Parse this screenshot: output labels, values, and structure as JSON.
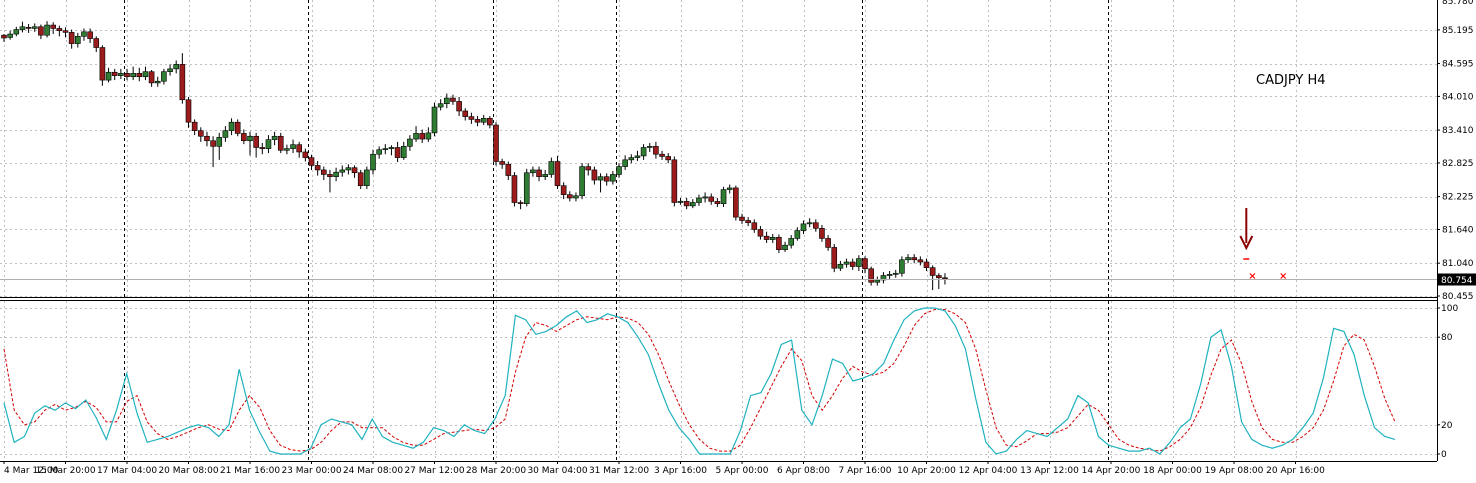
{
  "chart_data": {
    "type": "candlestick",
    "title": "CADJPY H4",
    "colors": {
      "bull_candle": "#2e7d32",
      "bear_candle": "#9b1c1c",
      "wick": "#000000",
      "stoch_main": "#20b2c0",
      "stoch_signal": "#d40000",
      "marker_arrow": "#8b0000",
      "marker_x": "#ff0000",
      "grid": "#c0c0c0",
      "separator": "#000000"
    },
    "price_axis": {
      "ylim": [
        80.455,
        85.78
      ],
      "ticks": [
        "85.195",
        "84.595",
        "84.010",
        "83.410",
        "82.825",
        "82.225",
        "81.640",
        "81.040",
        "80.455"
      ],
      "top_label_partial": "85.780",
      "current_price": "80.754"
    },
    "time_axis": {
      "labels": [
        "4 Mar 12:00",
        "15 Mar 20:00",
        "17 Mar 04:00",
        "20 Mar 08:00",
        "21 Mar 16:00",
        "23 Mar 00:00",
        "24 Mar 08:00",
        "27 Mar 12:00",
        "28 Mar 20:00",
        "30 Mar 04:00",
        "31 Mar 12:00",
        "3 Apr 16:00",
        "5 Apr 00:00",
        "6 Apr 08:00",
        "7 Apr 16:00",
        "10 Apr 20:00",
        "12 Apr 04:00",
        "13 Apr 12:00",
        "14 Apr 20:00",
        "18 Apr 00:00",
        "19 Apr 08:00",
        "20 Apr 16:00"
      ],
      "label_bar_index": [
        0,
        10,
        20,
        30,
        40,
        50,
        60,
        70,
        80,
        90,
        100,
        110,
        120,
        130,
        140,
        150,
        160,
        170,
        180,
        190,
        200,
        210
      ],
      "day_separator_bar_index": [
        20,
        50,
        80,
        100,
        140,
        180
      ]
    },
    "candles": [
      [
        85.1,
        85.05,
        85.12,
        84.98
      ],
      [
        85.06,
        85.12,
        85.18,
        85.02
      ],
      [
        85.12,
        85.2,
        85.25,
        85.08
      ],
      [
        85.2,
        85.25,
        85.34,
        85.15
      ],
      [
        85.24,
        85.22,
        85.3,
        85.14
      ],
      [
        85.22,
        85.25,
        85.31,
        85.16
      ],
      [
        85.25,
        85.1,
        85.29,
        85.03
      ],
      [
        85.1,
        85.28,
        85.35,
        85.06
      ],
      [
        85.28,
        85.22,
        85.33,
        85.12
      ],
      [
        85.22,
        85.18,
        85.27,
        85.08
      ],
      [
        85.18,
        85.15,
        85.24,
        85.06
      ],
      [
        85.15,
        84.95,
        85.2,
        84.86
      ],
      [
        84.95,
        85.08,
        85.14,
        84.88
      ],
      [
        85.08,
        85.16,
        85.22,
        85.0
      ],
      [
        85.16,
        85.04,
        85.22,
        84.96
      ],
      [
        85.04,
        84.88,
        85.08,
        84.8
      ],
      [
        84.88,
        84.3,
        84.92,
        84.2
      ],
      [
        84.3,
        84.44,
        84.52,
        84.26
      ],
      [
        84.44,
        84.38,
        84.5,
        84.3
      ],
      [
        84.38,
        84.42,
        84.5,
        84.32
      ],
      [
        84.42,
        84.36,
        84.5,
        84.3
      ],
      [
        84.36,
        84.42,
        84.54,
        84.3
      ],
      [
        84.42,
        84.36,
        84.52,
        84.28
      ],
      [
        84.36,
        84.45,
        84.54,
        84.3
      ],
      [
        84.45,
        84.25,
        84.48,
        84.18
      ],
      [
        84.25,
        84.28,
        84.36,
        84.18
      ],
      [
        84.28,
        84.45,
        84.5,
        84.22
      ],
      [
        84.45,
        84.5,
        84.58,
        84.38
      ],
      [
        84.5,
        84.58,
        84.65,
        84.42
      ],
      [
        84.58,
        83.95,
        84.78,
        83.88
      ],
      [
        83.95,
        83.55,
        84.0,
        83.45
      ],
      [
        83.55,
        83.4,
        83.6,
        83.32
      ],
      [
        83.4,
        83.3,
        83.46,
        83.2
      ],
      [
        83.3,
        83.22,
        83.38,
        83.12
      ],
      [
        83.22,
        83.12,
        83.3,
        82.75
      ],
      [
        83.12,
        83.28,
        83.36,
        82.88
      ],
      [
        83.28,
        83.4,
        83.48,
        83.2
      ],
      [
        83.4,
        83.55,
        83.62,
        83.32
      ],
      [
        83.55,
        83.35,
        83.6,
        83.3
      ],
      [
        83.35,
        83.22,
        83.42,
        83.16
      ],
      [
        83.22,
        83.3,
        83.38,
        82.96
      ],
      [
        83.3,
        83.1,
        83.36,
        82.92
      ],
      [
        83.1,
        83.08,
        83.18,
        82.98
      ],
      [
        83.08,
        83.24,
        83.32,
        83.0
      ],
      [
        83.24,
        83.3,
        83.38,
        83.14
      ],
      [
        83.3,
        83.05,
        83.36,
        83.0
      ],
      [
        83.05,
        83.08,
        83.15,
        82.98
      ],
      [
        83.08,
        83.15,
        83.24,
        83.0
      ],
      [
        83.15,
        83.02,
        83.2,
        82.92
      ],
      [
        83.02,
        82.92,
        83.08,
        82.85
      ],
      [
        82.92,
        82.78,
        82.97,
        82.7
      ],
      [
        82.78,
        82.7,
        82.86,
        82.6
      ],
      [
        82.7,
        82.62,
        82.76,
        82.52
      ],
      [
        82.62,
        82.58,
        82.7,
        82.3
      ],
      [
        82.58,
        82.66,
        82.74,
        82.5
      ],
      [
        82.66,
        82.7,
        82.78,
        82.58
      ],
      [
        82.7,
        82.74,
        82.8,
        82.62
      ],
      [
        82.74,
        82.65,
        82.78,
        82.56
      ],
      [
        82.65,
        82.42,
        82.7,
        82.36
      ],
      [
        82.42,
        82.7,
        82.76,
        82.36
      ],
      [
        82.7,
        82.98,
        83.06,
        82.62
      ],
      [
        82.98,
        83.06,
        83.12,
        82.9
      ],
      [
        83.06,
        83.08,
        83.16,
        82.98
      ],
      [
        83.08,
        83.1,
        83.14,
        82.96
      ],
      [
        83.1,
        82.92,
        83.2,
        82.84
      ],
      [
        82.92,
        83.12,
        83.2,
        82.88
      ],
      [
        83.12,
        83.25,
        83.32,
        83.04
      ],
      [
        83.25,
        83.35,
        83.48,
        83.2
      ],
      [
        83.35,
        83.25,
        83.42,
        83.18
      ],
      [
        83.25,
        83.36,
        83.46,
        83.2
      ],
      [
        83.36,
        83.82,
        83.9,
        83.3
      ],
      [
        83.82,
        83.88,
        83.96,
        83.76
      ],
      [
        83.88,
        83.98,
        84.06,
        83.8
      ],
      [
        83.98,
        83.92,
        84.04,
        83.86
      ],
      [
        83.92,
        83.75,
        84.0,
        83.66
      ],
      [
        83.75,
        83.65,
        83.8,
        83.58
      ],
      [
        83.65,
        83.6,
        83.72,
        83.52
      ],
      [
        83.6,
        83.55,
        83.66,
        83.48
      ],
      [
        83.55,
        83.62,
        83.68,
        83.5
      ],
      [
        83.62,
        83.5,
        83.66,
        83.44
      ],
      [
        83.5,
        82.85,
        83.55,
        82.78
      ],
      [
        82.85,
        82.8,
        82.9,
        82.72
      ],
      [
        82.8,
        82.6,
        82.85,
        82.52
      ],
      [
        82.6,
        82.12,
        82.66,
        82.05
      ],
      [
        82.12,
        82.1,
        82.16,
        82.0
      ],
      [
        82.1,
        82.65,
        82.72,
        82.05
      ],
      [
        82.65,
        82.7,
        82.76,
        82.58
      ],
      [
        82.7,
        82.58,
        82.76,
        82.5
      ],
      [
        82.58,
        82.62,
        82.7,
        82.52
      ],
      [
        82.62,
        82.85,
        82.92,
        82.56
      ],
      [
        82.85,
        82.42,
        82.95,
        82.36
      ],
      [
        82.42,
        82.26,
        82.48,
        82.18
      ],
      [
        82.26,
        82.2,
        82.32,
        82.14
      ],
      [
        82.2,
        82.24,
        82.3,
        82.14
      ],
      [
        82.24,
        82.76,
        82.82,
        82.18
      ],
      [
        82.76,
        82.7,
        82.82,
        82.6
      ],
      [
        82.7,
        82.52,
        82.76,
        82.44
      ],
      [
        82.52,
        82.58,
        82.64,
        82.3
      ],
      [
        82.58,
        82.5,
        82.64,
        82.42
      ],
      [
        82.5,
        82.62,
        82.68,
        82.44
      ],
      [
        82.62,
        82.76,
        82.82,
        82.56
      ],
      [
        82.76,
        82.88,
        82.96,
        82.7
      ],
      [
        82.88,
        82.92,
        82.98,
        82.82
      ],
      [
        82.92,
        82.95,
        83.04,
        82.86
      ],
      [
        82.95,
        83.1,
        83.16,
        82.88
      ],
      [
        83.1,
        83.12,
        83.18,
        83.02
      ],
      [
        83.12,
        82.98,
        83.2,
        82.9
      ],
      [
        82.98,
        82.94,
        83.04,
        82.88
      ],
      [
        82.94,
        82.88,
        83.0,
        82.82
      ],
      [
        82.88,
        82.12,
        82.94,
        82.05
      ],
      [
        82.12,
        82.14,
        82.2,
        82.08
      ],
      [
        82.14,
        82.06,
        82.2,
        82.0
      ],
      [
        82.06,
        82.12,
        82.18,
        82.02
      ],
      [
        82.12,
        82.2,
        82.26,
        82.06
      ],
      [
        82.2,
        82.22,
        82.3,
        82.12
      ],
      [
        82.22,
        82.14,
        82.28,
        82.08
      ],
      [
        82.14,
        82.1,
        82.2,
        82.04
      ],
      [
        82.1,
        82.35,
        82.4,
        82.04
      ],
      [
        82.35,
        82.38,
        82.44,
        82.28
      ],
      [
        82.38,
        81.86,
        82.42,
        81.8
      ],
      [
        81.86,
        81.8,
        81.92,
        81.74
      ],
      [
        81.8,
        81.76,
        81.86,
        81.7
      ],
      [
        81.76,
        81.64,
        81.82,
        81.58
      ],
      [
        81.64,
        81.52,
        81.7,
        81.46
      ],
      [
        81.52,
        81.46,
        81.6,
        81.4
      ],
      [
        81.46,
        81.5,
        81.56,
        81.4
      ],
      [
        81.5,
        81.28,
        81.55,
        81.22
      ],
      [
        81.28,
        81.36,
        81.42,
        81.24
      ],
      [
        81.36,
        81.48,
        81.54,
        81.3
      ],
      [
        81.48,
        81.62,
        81.68,
        81.44
      ],
      [
        81.62,
        81.74,
        81.8,
        81.56
      ],
      [
        81.74,
        81.76,
        81.84,
        81.68
      ],
      [
        81.76,
        81.66,
        81.82,
        81.6
      ],
      [
        81.66,
        81.48,
        81.72,
        81.42
      ],
      [
        81.48,
        81.32,
        81.54,
        81.26
      ],
      [
        81.32,
        80.95,
        81.38,
        80.88
      ],
      [
        80.95,
        81.02,
        81.08,
        80.9
      ],
      [
        81.02,
        81.06,
        81.12,
        80.96
      ],
      [
        81.06,
        80.98,
        81.12,
        80.92
      ],
      [
        80.98,
        81.12,
        81.18,
        80.9
      ],
      [
        81.12,
        80.94,
        81.16,
        80.86
      ],
      [
        80.94,
        80.7,
        80.98,
        80.64
      ],
      [
        80.7,
        80.74,
        80.8,
        80.64
      ],
      [
        80.74,
        80.82,
        80.88,
        80.68
      ],
      [
        80.82,
        80.84,
        80.9,
        80.76
      ],
      [
        80.84,
        80.86,
        80.92,
        80.78
      ],
      [
        80.86,
        81.1,
        81.16,
        80.8
      ],
      [
        81.1,
        81.14,
        81.2,
        81.04
      ],
      [
        81.14,
        81.1,
        81.2,
        81.04
      ],
      [
        81.1,
        81.06,
        81.16,
        81.0
      ],
      [
        81.06,
        80.96,
        81.12,
        80.9
      ],
      [
        80.96,
        80.82,
        81.0,
        80.56
      ],
      [
        80.82,
        80.78,
        80.86,
        80.58
      ],
      [
        80.78,
        80.76,
        80.86,
        80.66
      ]
    ],
    "candle_x_override": {
      "note_chart_fills_plot": true
    },
    "annotations": {
      "arrow_bar_index": 202,
      "signal_dash_bar_index": 202,
      "x_markers_bar_index": [
        203,
        208
      ]
    },
    "stochastic": {
      "axis_ticks": [
        "100",
        "80",
        "20",
        "0"
      ],
      "ylim": [
        0,
        100
      ],
      "main": [
        35,
        8,
        12,
        28,
        33,
        30,
        35,
        31,
        37,
        25,
        10,
        30,
        55,
        28,
        8,
        10,
        12,
        15,
        18,
        20,
        18,
        12,
        20,
        58,
        30,
        15,
        2,
        0,
        0,
        0,
        4,
        20,
        24,
        22,
        20,
        10,
        24,
        12,
        8,
        6,
        4,
        8,
        18,
        16,
        12,
        20,
        16,
        14,
        24,
        40,
        95,
        92,
        82,
        84,
        88,
        94,
        98,
        90,
        92,
        96,
        94,
        90,
        80,
        68,
        48,
        30,
        18,
        10,
        0,
        0,
        0,
        0,
        16,
        40,
        42,
        55,
        75,
        78,
        30,
        20,
        40,
        65,
        62,
        50,
        52,
        55,
        62,
        78,
        92,
        98,
        100,
        100,
        98,
        88,
        72,
        38,
        8,
        0,
        2,
        10,
        16,
        14,
        12,
        18,
        24,
        40,
        35,
        12,
        6,
        4,
        2,
        2,
        4,
        0,
        8,
        18,
        24,
        48,
        80,
        85,
        60,
        22,
        10,
        6,
        4,
        6,
        10,
        18,
        28,
        52,
        86,
        84,
        68,
        40,
        18,
        12,
        10
      ],
      "signal": [
        72,
        30,
        20,
        22,
        30,
        34,
        30,
        32,
        36,
        32,
        22,
        22,
        36,
        40,
        22,
        14,
        10,
        12,
        15,
        18,
        20,
        17,
        16,
        30,
        40,
        32,
        16,
        6,
        3,
        2,
        3,
        8,
        16,
        22,
        22,
        18,
        18,
        18,
        12,
        8,
        6,
        6,
        10,
        14,
        15,
        16,
        17,
        16,
        18,
        24,
        56,
        80,
        90,
        88,
        84,
        88,
        92,
        94,
        93,
        92,
        94,
        93,
        90,
        82,
        68,
        50,
        34,
        20,
        10,
        4,
        2,
        2,
        6,
        18,
        32,
        46,
        60,
        72,
        64,
        40,
        30,
        40,
        52,
        60,
        56,
        54,
        56,
        62,
        74,
        88,
        96,
        99,
        99,
        96,
        90,
        72,
        44,
        18,
        6,
        5,
        9,
        14,
        14,
        15,
        18,
        26,
        34,
        30,
        20,
        10,
        6,
        4,
        3,
        2,
        5,
        10,
        18,
        32,
        54,
        72,
        78,
        62,
        36,
        18,
        10,
        8,
        8,
        12,
        18,
        30,
        50,
        74,
        82,
        78,
        60,
        38,
        22
      ]
    }
  }
}
